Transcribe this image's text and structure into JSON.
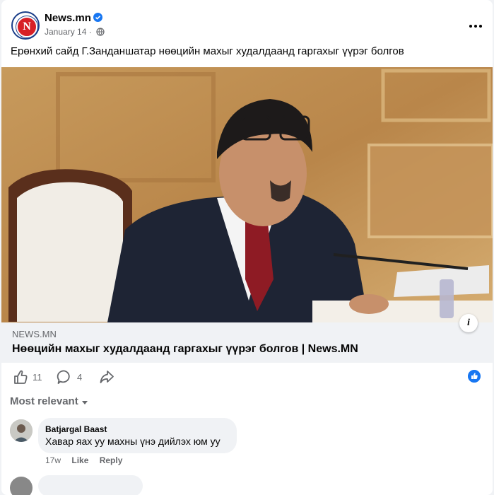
{
  "post": {
    "page_name": "News.mn",
    "avatar_letter": "N",
    "time": "January 14 ·",
    "caption": "Ерөнхий сайд Г.Занданшатар нөөцийн махыг худалдаанд гаргахыг үүрэг болгов",
    "link_domain": "NEWS.MN",
    "link_title": "Нөөцийн махыг худалдаанд гаргахыг үүрэг болгов | News.MN",
    "info_label": "i"
  },
  "actions": {
    "like_count": "11",
    "comment_count": "4"
  },
  "comments": {
    "sort_label": "Most relevant",
    "items": [
      {
        "author": "Batjargal Baast",
        "text": "Хавар яах уу махны үнэ дийлэх юм уу",
        "age": "17w",
        "like_label": "Like",
        "reply_label": "Reply"
      }
    ]
  },
  "icons": {
    "verified": "verified-badge-icon",
    "audience": "globe-icon",
    "more": "more-options-icon",
    "like": "thumbs-up-icon",
    "comment": "comment-bubble-icon",
    "share": "share-arrow-icon",
    "reaction": "like-reaction-icon",
    "sort": "caret-down-icon",
    "info": "info-icon"
  },
  "colors": {
    "brand_red": "#d71f26",
    "brand_blue": "#1c3f8a",
    "facebook_blue": "#1877f2"
  }
}
